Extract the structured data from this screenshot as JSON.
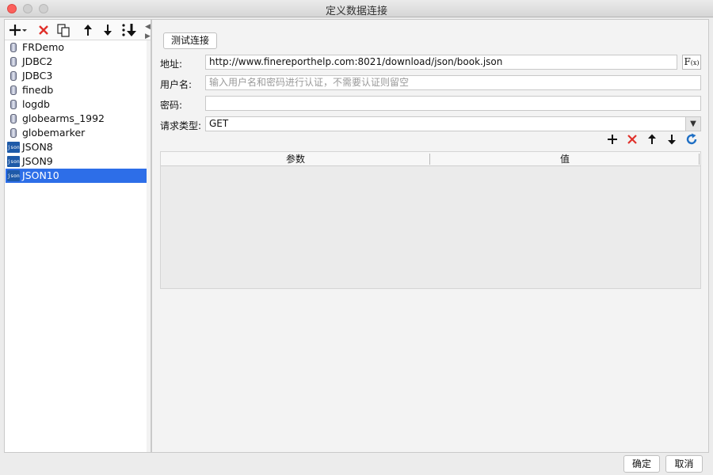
{
  "window": {
    "title": "定义数据连接"
  },
  "left_toolbar": {
    "add_icon": "plus-dropdown-icon",
    "delete_icon": "red-x-icon",
    "copy_icon": "copy-icon",
    "up_icon": "arrow-up-icon",
    "down_icon": "arrow-down-icon",
    "sort_icon": "sort-icon"
  },
  "connections": [
    {
      "label": "FRDemo",
      "type": "db"
    },
    {
      "label": "JDBC2",
      "type": "db"
    },
    {
      "label": "JDBC3",
      "type": "db"
    },
    {
      "label": "finedb",
      "type": "db"
    },
    {
      "label": "logdb",
      "type": "db"
    },
    {
      "label": "globearms_1992",
      "type": "db"
    },
    {
      "label": "globemarker",
      "type": "db"
    },
    {
      "label": "JSON8",
      "type": "json"
    },
    {
      "label": "JSON9",
      "type": "json"
    },
    {
      "label": "JSON10",
      "type": "json",
      "selected": true
    }
  ],
  "json_icon_text": "json",
  "form": {
    "test_button": "测试连接",
    "url_label": "地址:",
    "url_value": "http://www.finereporthelp.com:8021/download/json/book.json",
    "fx_label": "F",
    "fx_sub": "(x)",
    "user_label": "用户名:",
    "user_placeholder": "输入用户名和密码进行认证，不需要认证则留空",
    "password_label": "密码:",
    "password_value": "",
    "method_label": "请求类型:",
    "method_value": "GET"
  },
  "params_toolbar": {
    "add": "+",
    "delete": "✕",
    "up": "🠕",
    "down": "🠗",
    "refresh": "↻"
  },
  "params_table": {
    "col_param": "参数",
    "col_value": "值"
  },
  "footer": {
    "ok": "确定",
    "cancel": "取消"
  },
  "colors": {
    "selection": "#2d6ee8",
    "delete_red": "#e0302a",
    "refresh_blue": "#1f6fc4"
  }
}
